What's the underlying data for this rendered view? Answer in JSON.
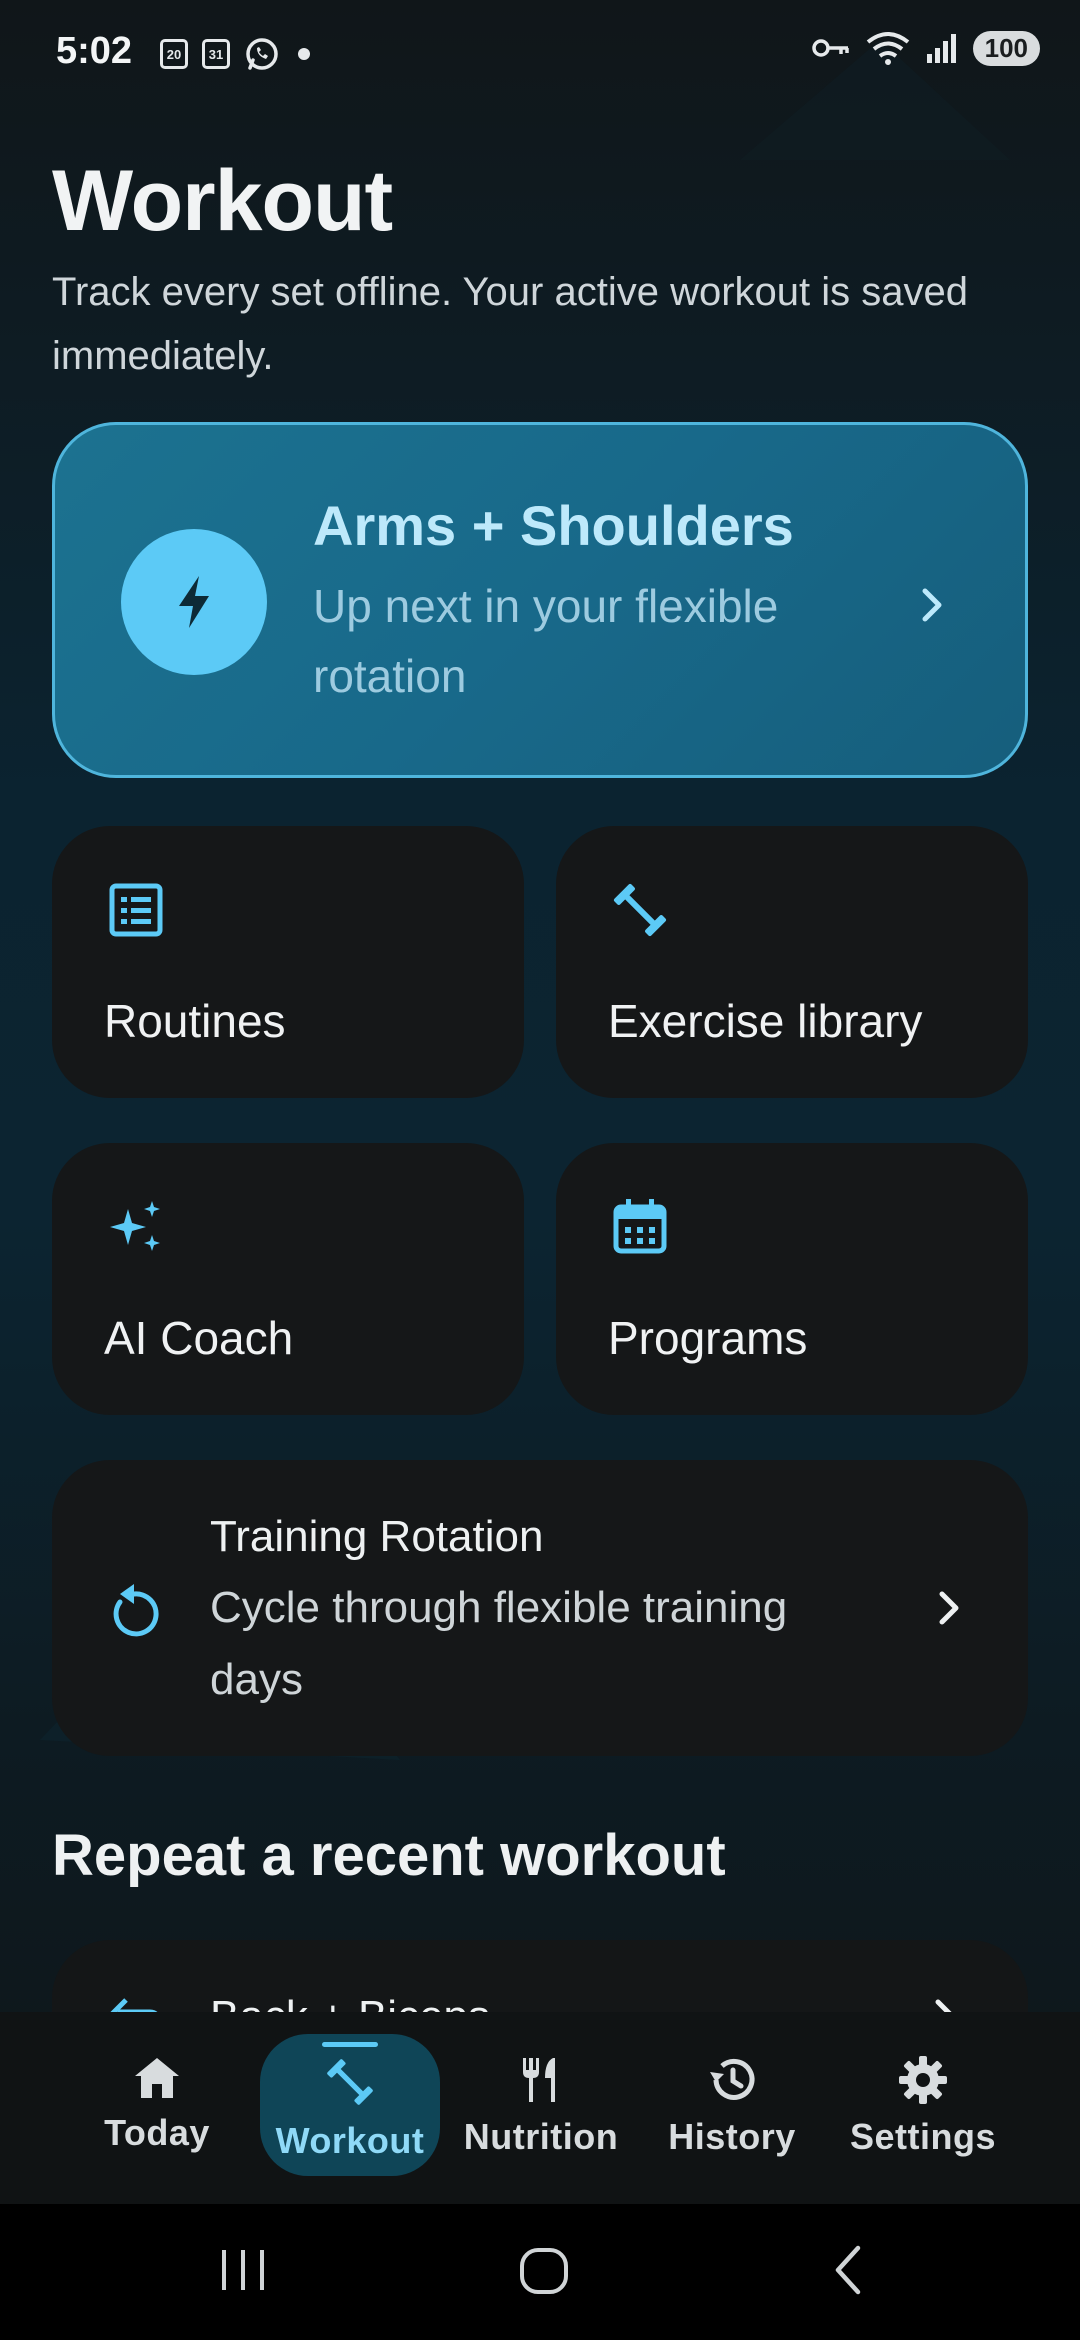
{
  "status_bar": {
    "time": "5:02",
    "calendar_day_1": "20",
    "calendar_day_2": "31",
    "battery": "100"
  },
  "header": {
    "title": "Workout",
    "subtitle": "Track every set offline. Your active workout is saved immediately."
  },
  "next_up": {
    "title": "Arms + Shoulders",
    "subtitle": "Up next in your flexible rotation",
    "icon": "bolt-icon"
  },
  "tiles": [
    {
      "label": "Routines",
      "icon": "list-icon"
    },
    {
      "label": "Exercise library",
      "icon": "dumbbell-icon"
    },
    {
      "label": "AI Coach",
      "icon": "sparkle-icon"
    },
    {
      "label": "Programs",
      "icon": "calendar-icon"
    }
  ],
  "rotation": {
    "title": "Training Rotation",
    "subtitle": "Cycle through flexible training days",
    "icon": "rotate-icon"
  },
  "recent": {
    "heading": "Repeat a recent workout",
    "first_item": "Back + Biceps"
  },
  "bottom_nav": [
    {
      "label": "Today",
      "icon": "home-icon",
      "active": false
    },
    {
      "label": "Workout",
      "icon": "dumbbell-icon",
      "active": true
    },
    {
      "label": "Nutrition",
      "icon": "fork-knife-icon",
      "active": false
    },
    {
      "label": "History",
      "icon": "history-icon",
      "active": false
    },
    {
      "label": "Settings",
      "icon": "gear-icon",
      "active": false
    }
  ],
  "colors": {
    "accent": "#5ccaf6",
    "card_bg": "#151718",
    "next_card_bg": "#18698a"
  }
}
